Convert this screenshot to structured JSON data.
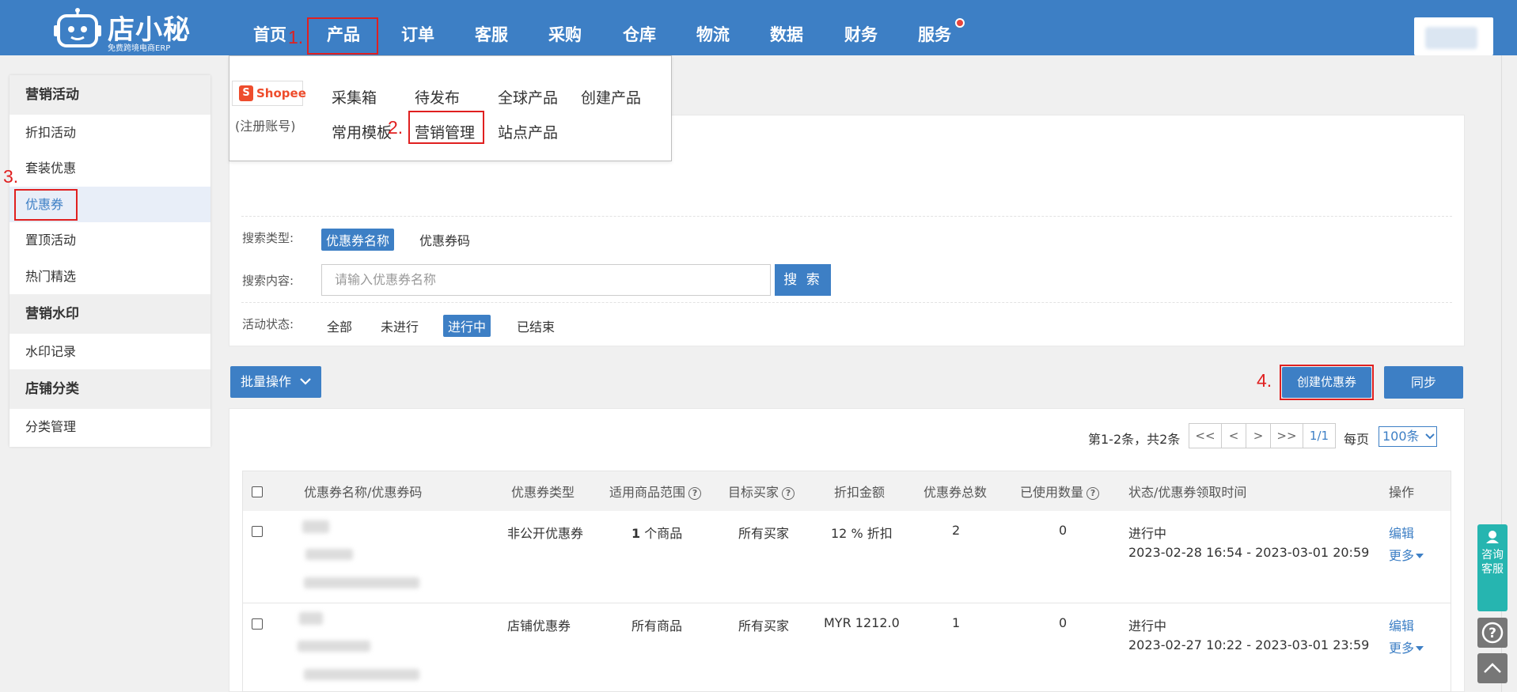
{
  "brand": {
    "name": "店小秘",
    "slogan": "免费跨境电商ERP"
  },
  "nav": {
    "items": [
      "首页",
      "产品",
      "订单",
      "客服",
      "采购",
      "仓库",
      "物流",
      "数据",
      "财务",
      "服务"
    ],
    "active": "产品"
  },
  "annotations": [
    "1.",
    "2.",
    "3.",
    "4."
  ],
  "dropdown": {
    "platform": "Shopee",
    "platform_note": "(注册账号)",
    "row1": [
      "采集箱",
      "待发布",
      "全球产品",
      "创建产品"
    ],
    "row2": [
      "常用模板",
      "营销管理",
      "站点产品"
    ]
  },
  "sidebar": {
    "sections": [
      {
        "title": "营销活动",
        "items": [
          "折扣活动",
          "套装优惠",
          "优惠券",
          "置顶活动",
          "热门精选"
        ]
      },
      {
        "title": "营销水印",
        "items": [
          "水印记录"
        ]
      },
      {
        "title": "店铺分类",
        "items": [
          "分类管理"
        ]
      }
    ],
    "active_item": "优惠券"
  },
  "search": {
    "type_label": "搜索类型:",
    "type_options": [
      "优惠券名称",
      "优惠券码"
    ],
    "type_selected": "优惠券名称",
    "content_label": "搜索内容:",
    "placeholder": "请输入优惠券名称",
    "button": "搜 索",
    "status_label": "活动状态:",
    "status_options": [
      "全部",
      "未进行",
      "进行中",
      "已结束"
    ],
    "status_selected": "进行中"
  },
  "actions": {
    "batch": "批量操作",
    "create": "创建优惠券",
    "sync": "同步"
  },
  "pagination": {
    "summary": "第1-2条，共2条",
    "first": "<<",
    "prev": "<",
    "next": ">",
    "last": ">>",
    "page": "1/1",
    "per_page_label": "每页",
    "per_page": "100条"
  },
  "table": {
    "headers": [
      "优惠券名称/优惠券码",
      "优惠券类型",
      "适用商品范围",
      "目标买家",
      "折扣金额",
      "优惠券总数",
      "已使用数量",
      "状态/优惠券领取时间",
      "操作"
    ],
    "rows": [
      {
        "type": "非公开优惠券",
        "scope_num": "1",
        "scope": "个商品",
        "buyers": "所有买家",
        "discount": "12 % 折扣",
        "total": "2",
        "used": "0",
        "status": "进行中",
        "time": "2023-02-28 16:54 - 2023-03-01 20:59",
        "edit": "编辑",
        "more": "更多"
      },
      {
        "type": "店铺优惠券",
        "scope_num": "",
        "scope": "所有商品",
        "buyers": "所有买家",
        "discount": "MYR 1212.0",
        "total": "1",
        "used": "0",
        "status": "进行中",
        "time": "2023-02-27 10:22 - 2023-03-01 23:59",
        "edit": "编辑",
        "more": "更多"
      }
    ]
  },
  "float": {
    "consult": "咨询客服",
    "help": "?"
  },
  "colors": {
    "primary": "#3d7fc5",
    "annotation": "#e02020",
    "consult": "#26b5b0"
  }
}
